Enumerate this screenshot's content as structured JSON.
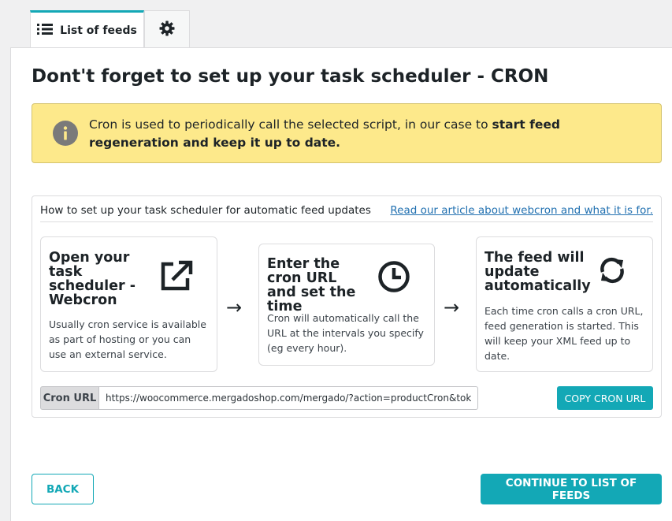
{
  "tabs": {
    "list_label": "List of feeds",
    "list_icon": "list-icon",
    "settings_icon": "gear-icon"
  },
  "page": {
    "title": "Dont't forget to set up your task scheduler - CRON"
  },
  "notice": {
    "icon": "info-icon",
    "text_start": "Cron is used to periodically call the selected script, in our case to ",
    "text_bold": "start feed regeneration and keep it up to date."
  },
  "card": {
    "heading": "How to set up your task scheduler for automatic feed updates",
    "link": "Read our article about webcron and what it is for.",
    "steps": [
      {
        "title": "Open your task scheduler - Webcron",
        "description": "Usually cron service is available as part of hosting or you can use an external service.",
        "icon": "external-link-icon"
      },
      {
        "title": "Enter the cron URL and set the time",
        "description": "Cron will automatically call the URL at the intervals you specify (eg every hour).",
        "icon": "clock-icon"
      },
      {
        "title": "The feed will update automatically",
        "description": "Each time cron calls a cron URL, feed generation is started. This will keep your XML feed up to date.",
        "icon": "refresh-icon"
      }
    ],
    "arrow": "→",
    "cron_label": "Cron URL",
    "cron_url": "https://woocommerce.mergadoshop.com/mergado/?action=productCron&token=…",
    "copy_button": "COPY CRON URL"
  },
  "footer": {
    "back_button": "BACK",
    "continue_button": "CONTINUE TO LIST OF FEEDS"
  },
  "colors": {
    "accent": "#13a8b6",
    "notice_bg": "#fde98b",
    "link": "#2271b1"
  }
}
